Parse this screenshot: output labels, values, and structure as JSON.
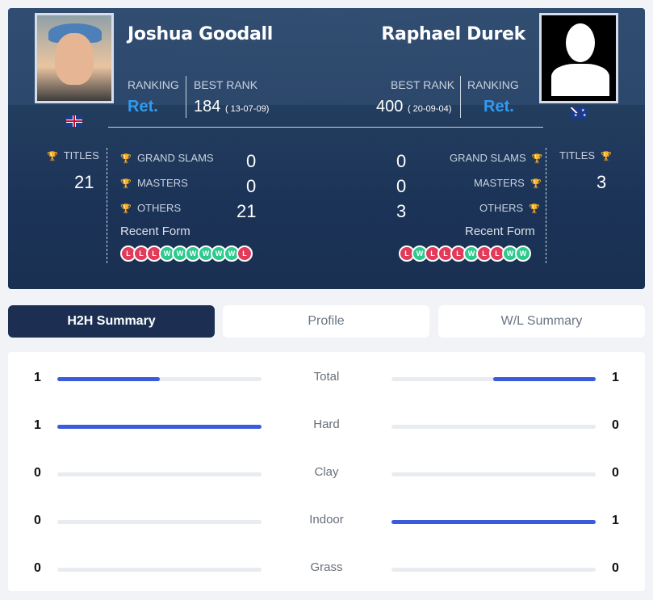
{
  "player_left": {
    "name": "Joshua Goodall",
    "flag": "gb-flag",
    "ranking_label": "RANKING",
    "ranking_value": "Ret.",
    "best_rank_label": "BEST RANK",
    "best_rank_value": "184",
    "best_rank_date": "( 13-07-09)",
    "titles_label": "TITLES",
    "titles_value": "21",
    "grand_slams_label": "GRAND SLAMS",
    "grand_slams_value": "0",
    "masters_label": "MASTERS",
    "masters_value": "0",
    "others_label": "OTHERS",
    "others_value": "21",
    "recent_form_label": "Recent Form",
    "recent_form": [
      "L",
      "L",
      "L",
      "W",
      "W",
      "W",
      "W",
      "W",
      "W",
      "L"
    ]
  },
  "player_right": {
    "name": "Raphael Durek",
    "flag": "au-flag",
    "ranking_label": "RANKING",
    "ranking_value": "Ret.",
    "best_rank_label": "BEST RANK",
    "best_rank_value": "400",
    "best_rank_date": "( 20-09-04)",
    "titles_label": "TITLES",
    "titles_value": "3",
    "grand_slams_label": "GRAND SLAMS",
    "grand_slams_value": "0",
    "masters_label": "MASTERS",
    "masters_value": "0",
    "others_label": "OTHERS",
    "others_value": "3",
    "recent_form_label": "Recent Form",
    "recent_form": [
      "L",
      "W",
      "L",
      "L",
      "L",
      "W",
      "L",
      "L",
      "W",
      "W"
    ]
  },
  "tabs": [
    {
      "label": "H2H Summary",
      "active": true
    },
    {
      "label": "Profile",
      "active": false
    },
    {
      "label": "W/L Summary",
      "active": false
    }
  ],
  "h2h": [
    {
      "category": "Total",
      "left": "1",
      "right": "1",
      "left_fraction": 0.5,
      "right_fraction": 0.5
    },
    {
      "category": "Hard",
      "left": "1",
      "right": "0",
      "left_fraction": 1.0,
      "right_fraction": 0
    },
    {
      "category": "Clay",
      "left": "0",
      "right": "0",
      "left_fraction": 0,
      "right_fraction": 0
    },
    {
      "category": "Indoor",
      "left": "0",
      "right": "1",
      "left_fraction": 0,
      "right_fraction": 1.0
    },
    {
      "category": "Grass",
      "left": "0",
      "right": "0",
      "left_fraction": 0,
      "right_fraction": 0
    }
  ],
  "colors": {
    "accent": "#3a5bde",
    "rank": "#2f9bf0",
    "win": "#2dc98d",
    "loss": "#e23a59",
    "active_tab": "#1c2f52"
  }
}
